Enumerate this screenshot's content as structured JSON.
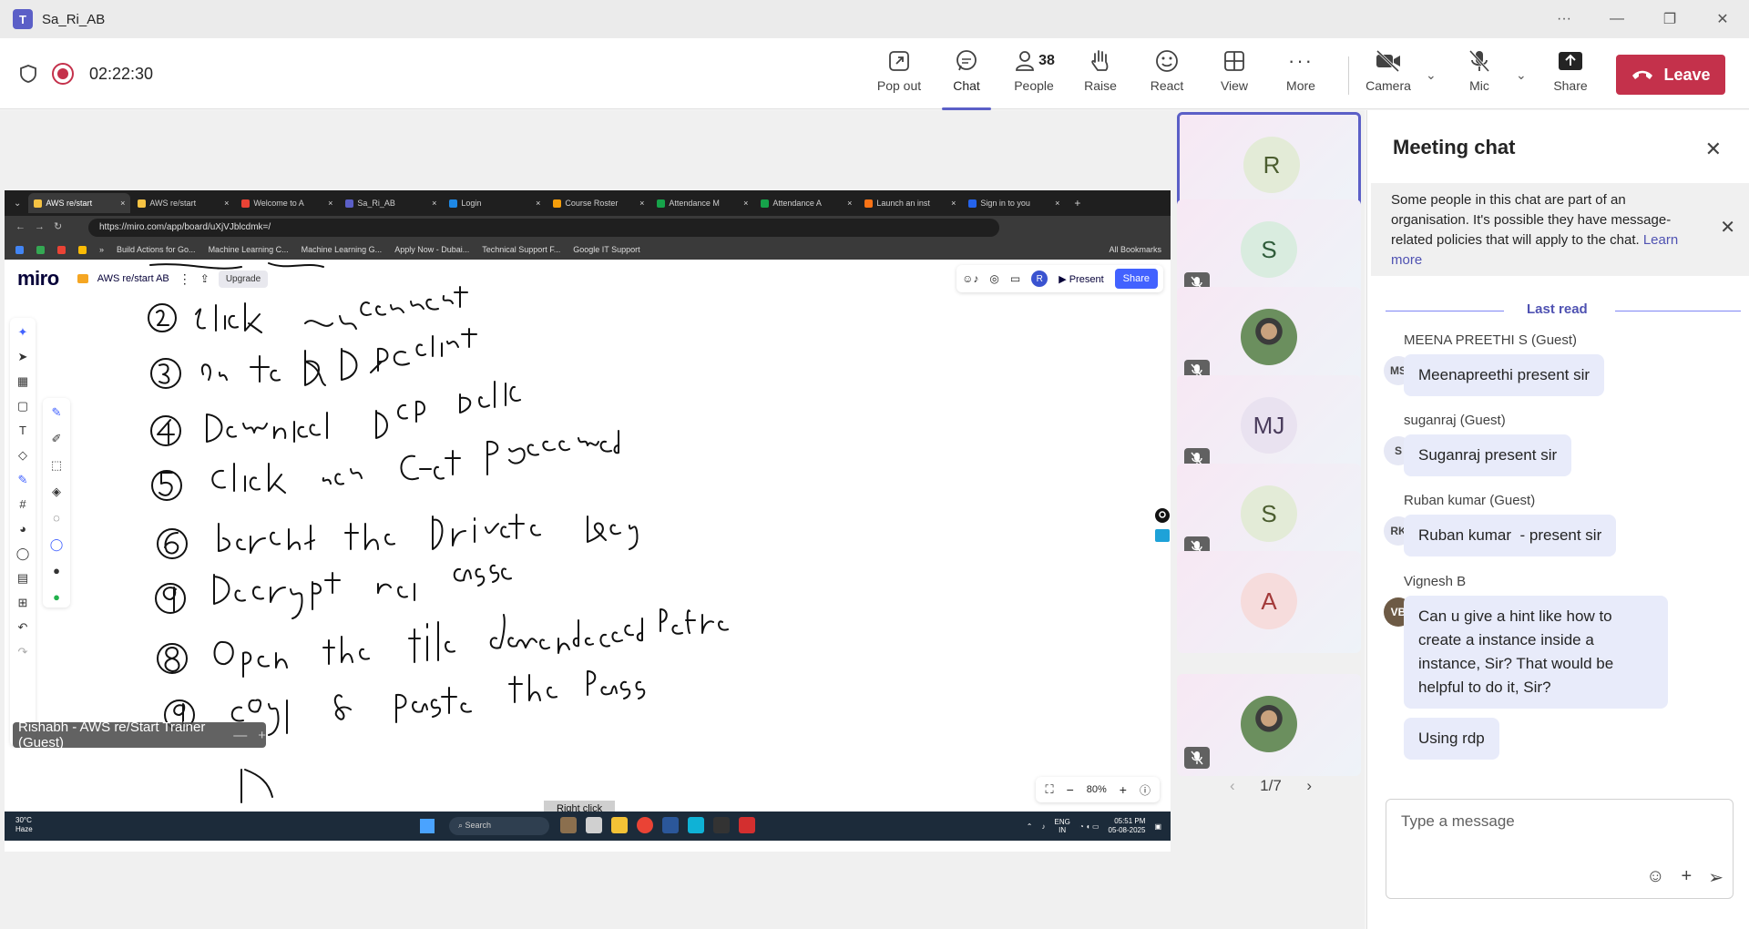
{
  "window": {
    "title": "Sa_Ri_AB"
  },
  "meeting": {
    "timer": "02:22:30",
    "toolbar": {
      "pop_out": "Pop out",
      "chat": "Chat",
      "people": "People",
      "people_count": "38",
      "raise": "Raise",
      "react": "React",
      "view": "View",
      "more": "More",
      "camera": "Camera",
      "mic": "Mic",
      "share": "Share",
      "leave": "Leave"
    },
    "accent_color": "#5b5fc7",
    "leave_color": "#c4314b"
  },
  "shared_screen": {
    "browser_tabs": [
      {
        "label": "AWS re/start",
        "color": "#f6c343"
      },
      {
        "label": "AWS re/start",
        "color": "#f6c343"
      },
      {
        "label": "Welcome to A",
        "color": "#ea4335"
      },
      {
        "label": "Sa_Ri_AB",
        "color": "#5b5fc7"
      },
      {
        "label": "Login",
        "color": "#1e88e5"
      },
      {
        "label": "Course Roster",
        "color": "#f59e0b"
      },
      {
        "label": "Attendance M",
        "color": "#16a34a"
      },
      {
        "label": "Attendance A",
        "color": "#16a34a"
      },
      {
        "label": "Launch an inst",
        "color": "#f97316"
      },
      {
        "label": "Sign in to you",
        "color": "#2563eb"
      }
    ],
    "url": "https://miro.com/app/board/uXjVJblcdmk=/",
    "bookmarks": [
      "Build Actions for Go...",
      "Machine Learning C...",
      "Machine Learning G...",
      "Apply Now - Dubai...",
      "Technical Support F...",
      "Google IT Support"
    ],
    "all_bookmarks": "All Bookmarks",
    "miro": {
      "logo": "miro",
      "board_name": "AWS re/start AB",
      "upgrade": "Upgrade",
      "present": "Present",
      "share": "Share",
      "avatar": "R",
      "zoom": "80%"
    },
    "tooltip": "Right click",
    "taskbar": {
      "temp": "30°C",
      "weather": "Haze",
      "search": "Search",
      "lang": "ENG",
      "region": "IN",
      "time": "05:51 PM",
      "date": "05-08-2025"
    },
    "speaker_label": "Rishabh - AWS re/Start Trainer (Guest)"
  },
  "participants": [
    {
      "initials": "R",
      "bg": "#e3ebd7",
      "fg": "#4b5d2f",
      "muted": false,
      "selected": true
    },
    {
      "initials": "S",
      "bg": "#d9ecdf",
      "fg": "#2f5c3a",
      "muted": true
    },
    {
      "initials": "",
      "photo": true,
      "muted": true
    },
    {
      "initials": "MJ",
      "bg": "#e9e2f0",
      "fg": "#4a3c5c",
      "muted": true
    },
    {
      "initials": "S",
      "bg": "#e3ebd7",
      "fg": "#4b5d2f",
      "muted": true
    },
    {
      "initials": "A",
      "bg": "#f6dcdc",
      "fg": "#a33a3a",
      "muted": false
    },
    {
      "initials": "",
      "photo": true,
      "muted": true
    }
  ],
  "pager": "1/7",
  "chat": {
    "title": "Meeting chat",
    "notice": "Some people in this chat are part of an organisation. It's possible they have message-related policies that will apply to the chat.",
    "notice_link": "Learn more",
    "last_read": "Last read",
    "messages": [
      {
        "author": "MEENA PREETHI S (Guest)",
        "initials": "MS",
        "text": "Meenapreethi present sir"
      },
      {
        "author": "suganraj (Guest)",
        "initials": "S",
        "text": "Suganraj present sir"
      },
      {
        "author": "Ruban kumar (Guest)",
        "initials": "RK",
        "text": "Ruban kumar  - present sir"
      },
      {
        "author": "Vignesh B",
        "initials": "VB",
        "text": "Can u give a hint like how to create a instance inside a instance, Sir? That would be helpful to do it, Sir?",
        "followup": "Using rdp"
      }
    ],
    "placeholder": "Type a message"
  }
}
